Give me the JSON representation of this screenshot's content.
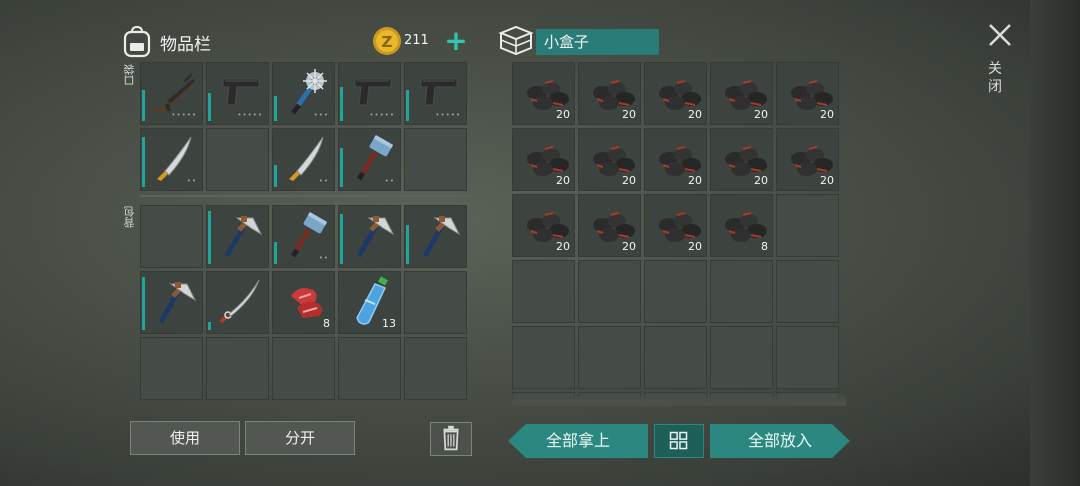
{
  "inventory": {
    "title": "物品栏",
    "pocket_label": "口袋",
    "backpack_label": "背包",
    "coins": "211",
    "plus": "+"
  },
  "container": {
    "title": "小盒子",
    "close_label": "关闭"
  },
  "buttons": {
    "use": "使用",
    "split": "分开",
    "take_all": "全部拿上",
    "put_all": "全部放入"
  },
  "colors": {
    "accent_teal": "#2a8880",
    "durability": "#22a599"
  },
  "pocket_slots": [
    {
      "icon": "ak-rifle-icon",
      "durability": 0.55,
      "dots": "•••••"
    },
    {
      "icon": "pistol-icon",
      "durability": 0.5,
      "dots": "•••••"
    },
    {
      "icon": "spiked-club-icon",
      "durability": 0.45,
      "dots": "•••"
    },
    {
      "icon": "pistol-icon",
      "durability": 0.6,
      "dots": "•••••"
    },
    {
      "icon": "pistol-icon",
      "durability": 0.55,
      "dots": "•••••"
    },
    {
      "icon": "machete-icon",
      "durability": 0.9,
      "dots": "••"
    },
    {
      "icon": "",
      "durability": 0,
      "dots": ""
    },
    {
      "icon": "machete-icon",
      "durability": 0.4,
      "dots": "••"
    },
    {
      "icon": "sledgehammer-icon",
      "durability": 0.7,
      "dots": "••"
    },
    {
      "icon": "",
      "durability": 0,
      "dots": ""
    }
  ],
  "backpack_slots": [
    {
      "icon": "",
      "durability": 0,
      "dots": "",
      "qty": ""
    },
    {
      "icon": "hatchet-icon",
      "durability": 0.95,
      "dots": "",
      "qty": ""
    },
    {
      "icon": "sledgehammer-icon",
      "durability": 0.4,
      "dots": "••",
      "qty": ""
    },
    {
      "icon": "hatchet-icon",
      "durability": 0.9,
      "dots": "",
      "qty": ""
    },
    {
      "icon": "hatchet-icon",
      "durability": 0.7,
      "dots": "",
      "qty": ""
    },
    {
      "icon": "hatchet-icon",
      "durability": 0.95,
      "dots": "",
      "qty": ""
    },
    {
      "icon": "katana-icon",
      "durability": 0.15,
      "dots": "",
      "qty": ""
    },
    {
      "icon": "raw-meat-icon",
      "durability": 0,
      "dots": "",
      "qty": "8"
    },
    {
      "icon": "water-bottle-icon",
      "durability": 0,
      "dots": "",
      "qty": "13"
    },
    {
      "icon": "",
      "durability": 0,
      "dots": "",
      "qty": ""
    },
    {
      "icon": "",
      "durability": 0,
      "dots": "",
      "qty": ""
    },
    {
      "icon": "",
      "durability": 0,
      "dots": "",
      "qty": ""
    },
    {
      "icon": "",
      "durability": 0,
      "dots": "",
      "qty": ""
    },
    {
      "icon": "",
      "durability": 0,
      "dots": "",
      "qty": ""
    },
    {
      "icon": "",
      "durability": 0,
      "dots": "",
      "qty": ""
    }
  ],
  "container_slots": [
    {
      "icon": "coal-icon",
      "qty": "20"
    },
    {
      "icon": "coal-icon",
      "qty": "20"
    },
    {
      "icon": "coal-icon",
      "qty": "20"
    },
    {
      "icon": "coal-icon",
      "qty": "20"
    },
    {
      "icon": "coal-icon",
      "qty": "20"
    },
    {
      "icon": "coal-icon",
      "qty": "20"
    },
    {
      "icon": "coal-icon",
      "qty": "20"
    },
    {
      "icon": "coal-icon",
      "qty": "20"
    },
    {
      "icon": "coal-icon",
      "qty": "20"
    },
    {
      "icon": "coal-icon",
      "qty": "20"
    },
    {
      "icon": "coal-icon",
      "qty": "20"
    },
    {
      "icon": "coal-icon",
      "qty": "20"
    },
    {
      "icon": "coal-icon",
      "qty": "20"
    },
    {
      "icon": "coal-icon",
      "qty": "8"
    },
    {
      "icon": "",
      "qty": ""
    },
    {
      "icon": "",
      "qty": ""
    },
    {
      "icon": "",
      "qty": ""
    },
    {
      "icon": "",
      "qty": ""
    },
    {
      "icon": "",
      "qty": ""
    },
    {
      "icon": "",
      "qty": ""
    },
    {
      "icon": "",
      "qty": ""
    },
    {
      "icon": "",
      "qty": ""
    },
    {
      "icon": "",
      "qty": ""
    },
    {
      "icon": "",
      "qty": ""
    },
    {
      "icon": "",
      "qty": ""
    },
    {
      "icon": "",
      "qty": ""
    },
    {
      "icon": "",
      "qty": ""
    },
    {
      "icon": "",
      "qty": ""
    },
    {
      "icon": "",
      "qty": ""
    },
    {
      "icon": "",
      "qty": ""
    }
  ]
}
